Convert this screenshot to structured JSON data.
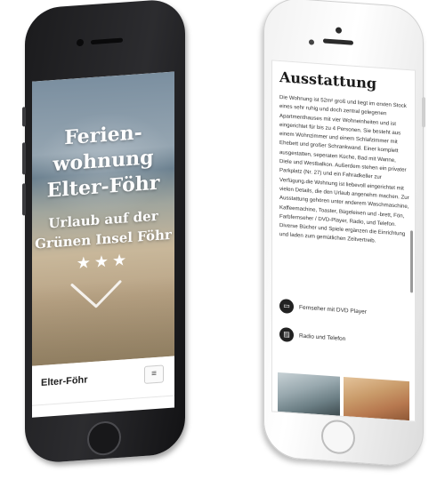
{
  "left_phone": {
    "hero": {
      "title_lines": [
        "Ferien-",
        "wohnung",
        "Elter-Föhr"
      ],
      "subtitle_lines": [
        "Urlaub auf der",
        "Grünen Insel Föhr"
      ],
      "stars": "★★★",
      "chevron_icon": "chevron-down-icon"
    },
    "navbar": {
      "brand": "Elter-Föhr",
      "menu_icon": "hamburger-icon",
      "menu_glyph": "≡"
    }
  },
  "right_phone": {
    "section_title": "Ausstattung",
    "body": "Die Wohnung ist 52m² groß und liegt im ersten Stock eines sehr ruhig und doch zentral gelegenen Apartmenthauses mit vier Wohneinheiten und ist eingerichtet für bis zu 4 Personen. Sie besteht aus einem Wohnzimmer und einem Schlafzimmer mit Ehebett und großer Schrankwand. Einer komplett ausgestatten, seperaten Küche, Bad mit Wanne, Diele und Westbalkon. Außerdem stehen ein privater Parkplatz (Nr. 27) und ein Fahradkeller zur Verfügung.die Wohnung ist liebevoll eingerichtet mit vielen Details, die den Urlaub angenehm machen. Zur Ausstattung gehören unter anderem Waschmaschine, Kaffeemachine, Toaster, Bügeleisen und -brett, Fön, Farbfernseher / DVD-Player, Radio, und Telefon. Diverse Bücher und Spiele ergänzen die Einrichtung und laden zum gemütlichen Zeitvertreib.",
    "features": [
      {
        "icon": "tv-icon",
        "glyph": "▭",
        "label": "Fernseher mit DVD Player"
      },
      {
        "icon": "radio-icon",
        "glyph": "▤",
        "label": "Radio und Telefon"
      }
    ]
  }
}
